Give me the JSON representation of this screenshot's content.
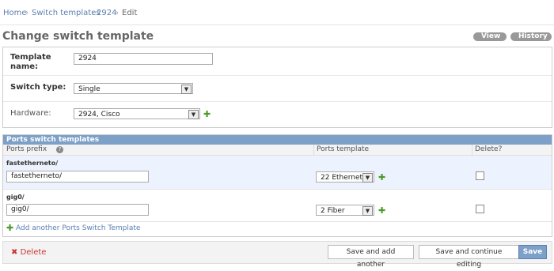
{
  "breadcrumbs": {
    "home": "Home",
    "sep1": "›",
    "switch_templates": "Switch templates",
    "sep2": "›",
    "item": "2924",
    "sep3": "›",
    "current": "Edit"
  },
  "page_title": "Change switch template",
  "object_tools": {
    "view": "View",
    "history": "History"
  },
  "form": {
    "template_name": {
      "label_line1": "Template",
      "label_line2": "name:",
      "value": "2924"
    },
    "switch_type": {
      "label": "Switch type:",
      "value": "Single"
    },
    "hardware": {
      "label": "Hardware:",
      "value": "2924, Cisco"
    }
  },
  "inline": {
    "title": "Ports switch templates",
    "columns": {
      "ports_prefix": "Ports prefix",
      "ports_template": "Ports template",
      "delete": "Delete?"
    },
    "help_icon": "help-icon",
    "rows": [
      {
        "title": "fastetherneto/",
        "prefix_value": "fastetherneto/",
        "template_value": "22 Ethernet"
      },
      {
        "title": "gig0/",
        "prefix_value": "gig0/",
        "template_value": "2 Fiber"
      }
    ],
    "add_link": "Add another Ports Switch Template"
  },
  "submit": {
    "delete": "Delete",
    "save_add_another": "Save and add another",
    "save_continue": "Save and continue editing",
    "save": "Save"
  },
  "colors": {
    "accent": "#7ca0c7",
    "link": "#5b80b2",
    "delete": "#cc3434",
    "add": "#4c9a2a"
  }
}
